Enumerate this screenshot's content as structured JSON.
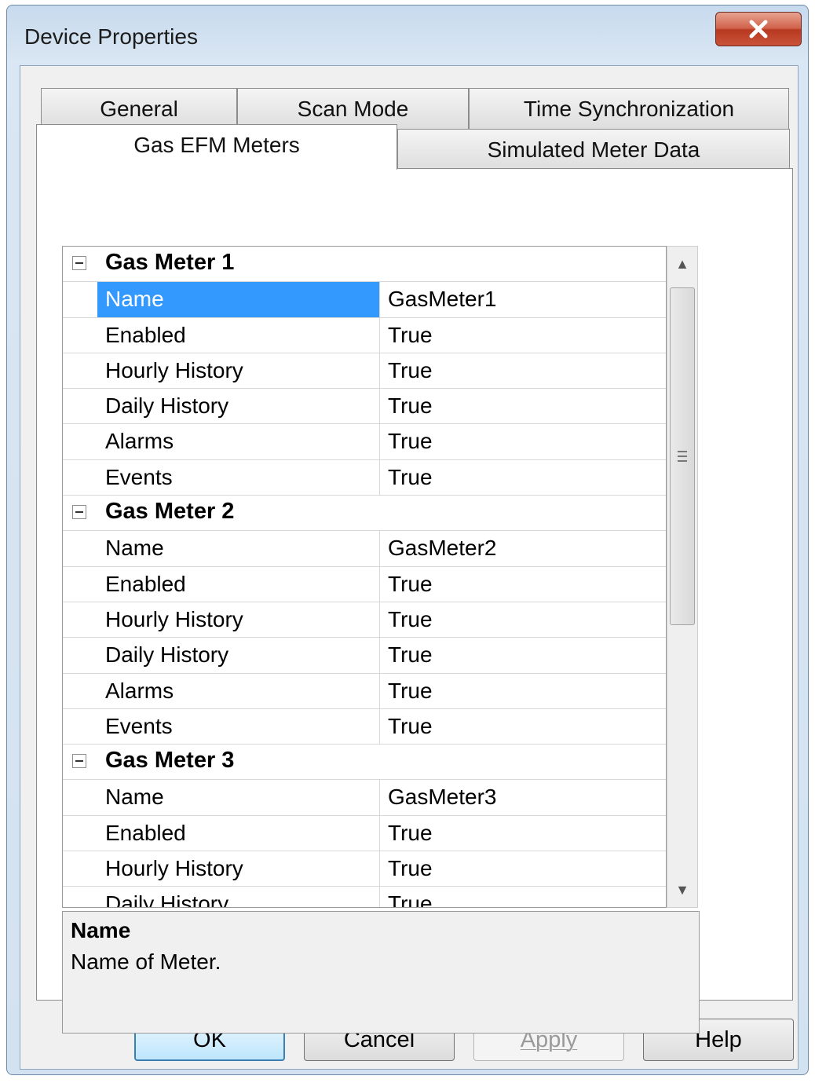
{
  "window": {
    "title": "Device Properties",
    "close_glyph": "X"
  },
  "tabs": {
    "row1": [
      "General",
      "Scan Mode",
      "Time Synchronization"
    ],
    "row2": [
      "Gas EFM Meters",
      "Simulated Meter Data"
    ],
    "active": "Gas EFM Meters"
  },
  "grid": {
    "meters": [
      {
        "title": "Gas Meter 1",
        "props": [
          {
            "name": "Name",
            "value": "GasMeter1"
          },
          {
            "name": "Enabled",
            "value": "True"
          },
          {
            "name": "Hourly History",
            "value": "True"
          },
          {
            "name": "Daily History",
            "value": "True"
          },
          {
            "name": "Alarms",
            "value": "True"
          },
          {
            "name": "Events",
            "value": "True"
          }
        ]
      },
      {
        "title": "Gas Meter 2",
        "props": [
          {
            "name": "Name",
            "value": "GasMeter2"
          },
          {
            "name": "Enabled",
            "value": "True"
          },
          {
            "name": "Hourly History",
            "value": "True"
          },
          {
            "name": "Daily History",
            "value": "True"
          },
          {
            "name": "Alarms",
            "value": "True"
          },
          {
            "name": "Events",
            "value": "True"
          }
        ]
      },
      {
        "title": "Gas Meter 3",
        "props": [
          {
            "name": "Name",
            "value": "GasMeter3"
          },
          {
            "name": "Enabled",
            "value": "True"
          },
          {
            "name": "Hourly History",
            "value": "True"
          },
          {
            "name": "Daily History",
            "value": "True"
          }
        ]
      }
    ],
    "selected": "Gas Meter 1 / Name"
  },
  "help": {
    "title": "Name",
    "description": "Name of Meter."
  },
  "buttons": {
    "ok": "OK",
    "cancel": "Cancel",
    "apply": "Apply",
    "help": "Help"
  },
  "colors": {
    "selection": "#3399ff",
    "close_button": "#c9533a"
  }
}
